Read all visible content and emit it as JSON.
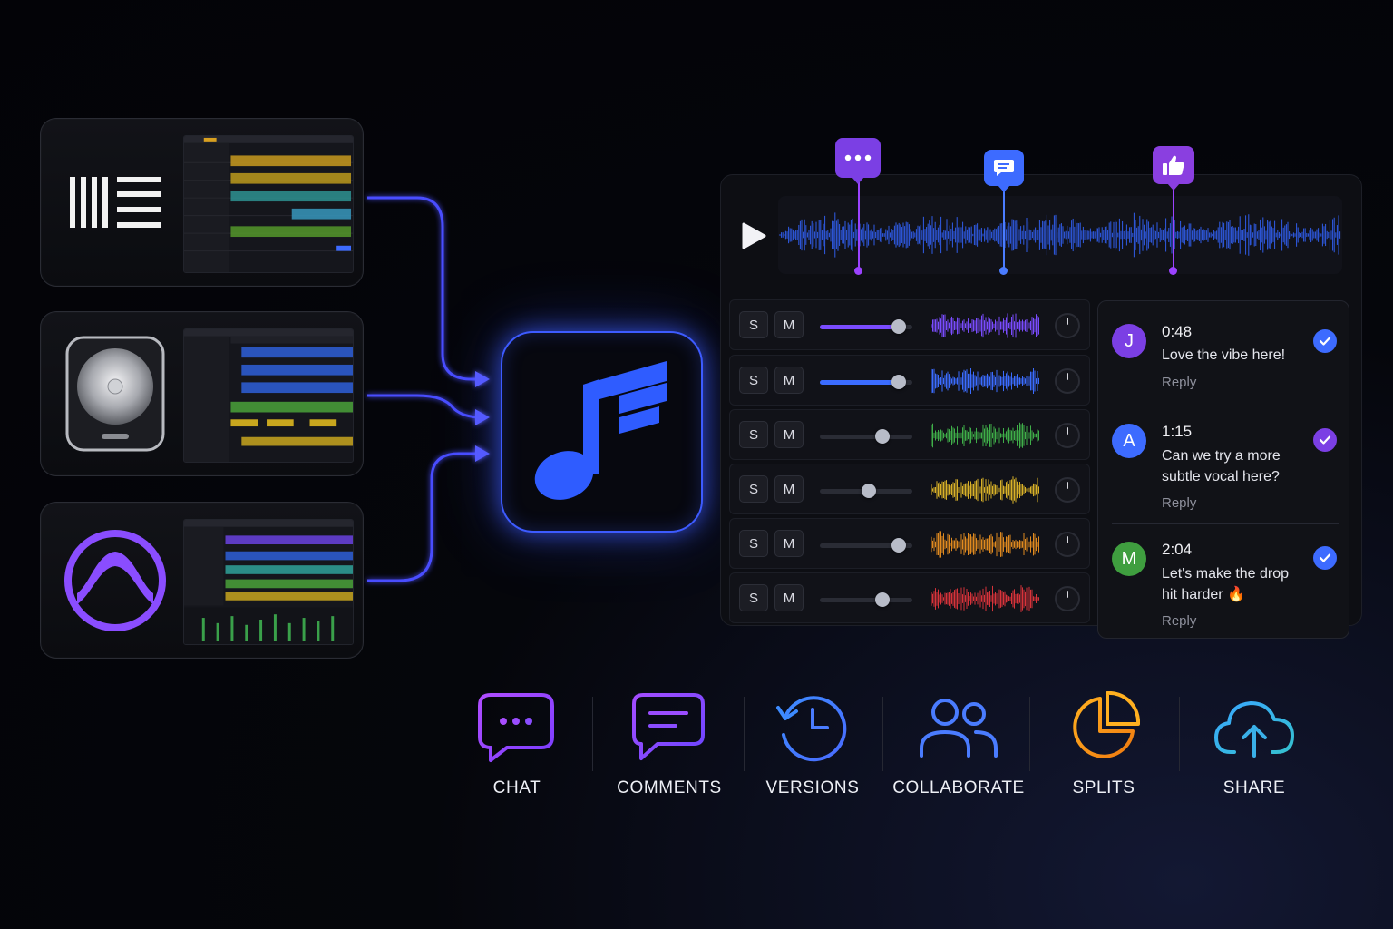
{
  "sources": [
    {
      "name": "ableton",
      "logo": "ableton-logo"
    },
    {
      "name": "logic",
      "logo": "logic-logo"
    },
    {
      "name": "pro-tools",
      "logo": "pro-tools-logo"
    }
  ],
  "hub": {
    "icon": "music-note-icon"
  },
  "player": {
    "play_icon": "play-icon",
    "markers": [
      {
        "type": "chat",
        "icon": "ellipsis-chat-icon",
        "color": "#7b3fe4"
      },
      {
        "type": "comment",
        "icon": "message-icon",
        "color": "#3d6bff"
      },
      {
        "type": "like",
        "icon": "thumbs-up-icon",
        "color": "#8a3fe0"
      }
    ]
  },
  "tracks": [
    {
      "solo": "S",
      "mute": "M",
      "level": 0.85,
      "color": "#7a4cff"
    },
    {
      "solo": "S",
      "mute": "M",
      "level": 0.85,
      "color": "#3b6cff"
    },
    {
      "solo": "S",
      "mute": "M",
      "level": 0.68,
      "color": "#3fae49"
    },
    {
      "solo": "S",
      "mute": "M",
      "level": 0.53,
      "color": "#d9b128"
    },
    {
      "solo": "S",
      "mute": "M",
      "level": 0.85,
      "color": "#e08a1f"
    },
    {
      "solo": "S",
      "mute": "M",
      "level": 0.68,
      "color": "#d8333a"
    }
  ],
  "comments": [
    {
      "initial": "J",
      "time": "0:48",
      "text": "Love the vibe here!",
      "reply": "Reply",
      "avatar_color": "#7b3fe4",
      "check_color": "#3d6bff"
    },
    {
      "initial": "A",
      "time": "1:15",
      "text": "Can we try a more subtle vocal here?",
      "reply": "Reply",
      "avatar_color": "#3d6bff",
      "check_color": "#7b3fe4"
    },
    {
      "initial": "M",
      "time": "2:04",
      "text": "Let's make the drop hit harder 🔥",
      "reply": "Reply",
      "avatar_color": "#3f9e3f",
      "check_color": "#3d6bff"
    }
  ],
  "features": [
    {
      "label": "CHAT",
      "icon": "chat-bubble-icon",
      "color": "#a34dff"
    },
    {
      "label": "COMMENTS",
      "icon": "comment-icon",
      "color": "#9b4dff"
    },
    {
      "label": "VERSIONS",
      "icon": "history-clock-icon",
      "color": "#4a7cff"
    },
    {
      "label": "COLLABORATE",
      "icon": "users-icon",
      "color": "#4a7cff"
    },
    {
      "label": "SPLITS",
      "icon": "pie-chart-icon",
      "color": "#f0a020"
    },
    {
      "label": "SHARE",
      "icon": "cloud-upload-icon",
      "color": "#3cb3e0"
    }
  ]
}
